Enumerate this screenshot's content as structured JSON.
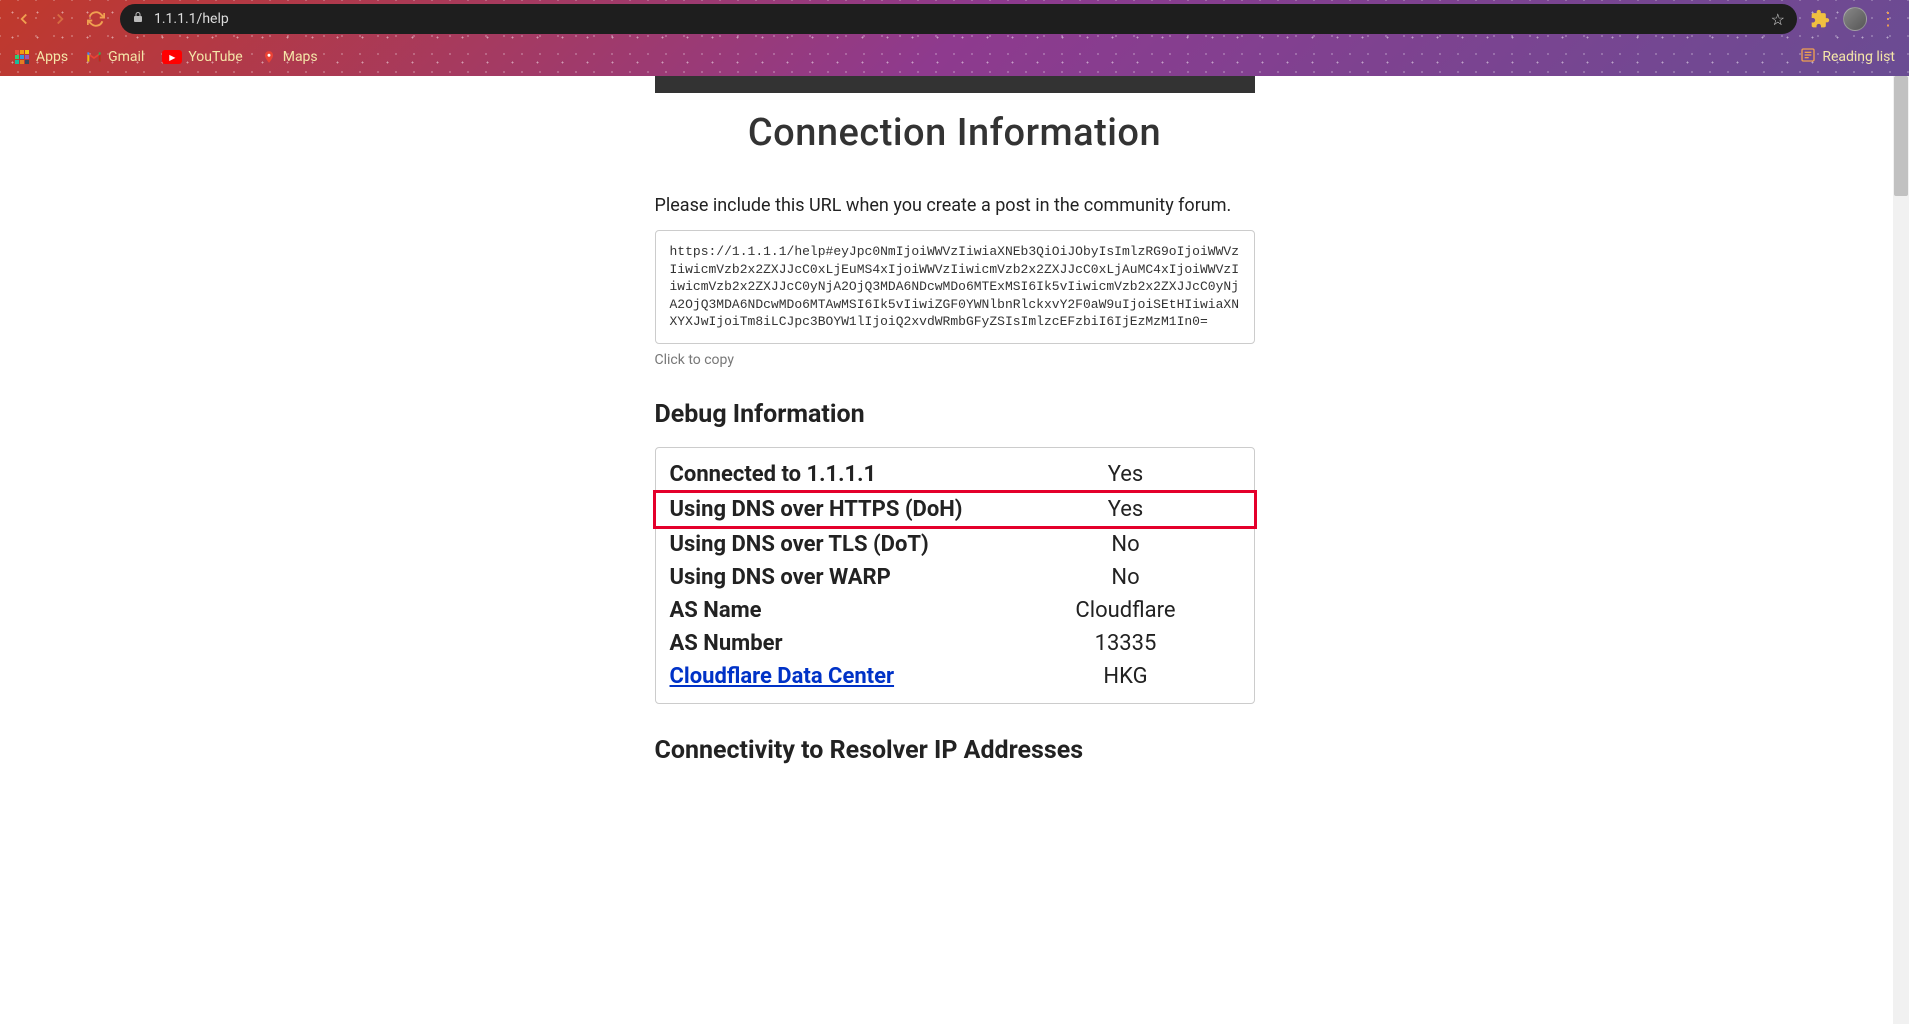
{
  "browser": {
    "url": "1.1.1.1/help",
    "bookmarks": [
      {
        "label": "Apps",
        "icon": "apps"
      },
      {
        "label": "Gmail",
        "icon": "gmail"
      },
      {
        "label": "YouTube",
        "icon": "youtube"
      },
      {
        "label": "Maps",
        "icon": "maps"
      }
    ],
    "reading_list": "Reading list"
  },
  "page": {
    "title": "Connection Information",
    "intro": "Please include this URL when you create a post in the community forum.",
    "share_url": "https://1.1.1.1/help#eyJpc0NmIjoiWWVzIiwiaXNEb3QiOiJObyIsImlzRG9oIjoiWWVzIiwicmVzb2x2ZXJJcC0xLjEuMS4xIjoiWWVzIiwicmVzb2x2ZXJJcC0xLjAuMC4xIjoiWWVzIiwicmVzb2x2ZXJJcC0yNjA2OjQ3MDA6NDcwMDo6MTExMSI6Ik5vIiwicmVzb2x2ZXJJcC0yNjA2OjQ3MDA6NDcwMDo6MTAwMSI6Ik5vIiwiZGF0YWNlbnRlckxvY2F0aW9uIjoiSEtHIiwiaXNXYXJwIjoiTm8iLCJpc3BOYW1lIjoiQ2xvdWRmbGFyZSIsImlzcEFzbiI6IjEzMzM1In0=",
    "copy_hint": "Click to copy",
    "debug_title": "Debug Information",
    "debug_rows": [
      {
        "label": "Connected to 1.1.1.1",
        "value": "Yes",
        "link": false,
        "highlighted": false
      },
      {
        "label": "Using DNS over HTTPS (DoH)",
        "value": "Yes",
        "link": false,
        "highlighted": true
      },
      {
        "label": "Using DNS over TLS (DoT)",
        "value": "No",
        "link": false,
        "highlighted": false
      },
      {
        "label": "Using DNS over WARP",
        "value": "No",
        "link": false,
        "highlighted": false
      },
      {
        "label": "AS Name",
        "value": "Cloudflare",
        "link": false,
        "highlighted": false
      },
      {
        "label": "AS Number",
        "value": "13335",
        "link": false,
        "highlighted": false
      },
      {
        "label": "Cloudflare Data Center",
        "value": "HKG",
        "link": true,
        "highlighted": false
      }
    ],
    "connectivity_title": "Connectivity to Resolver IP Addresses"
  }
}
